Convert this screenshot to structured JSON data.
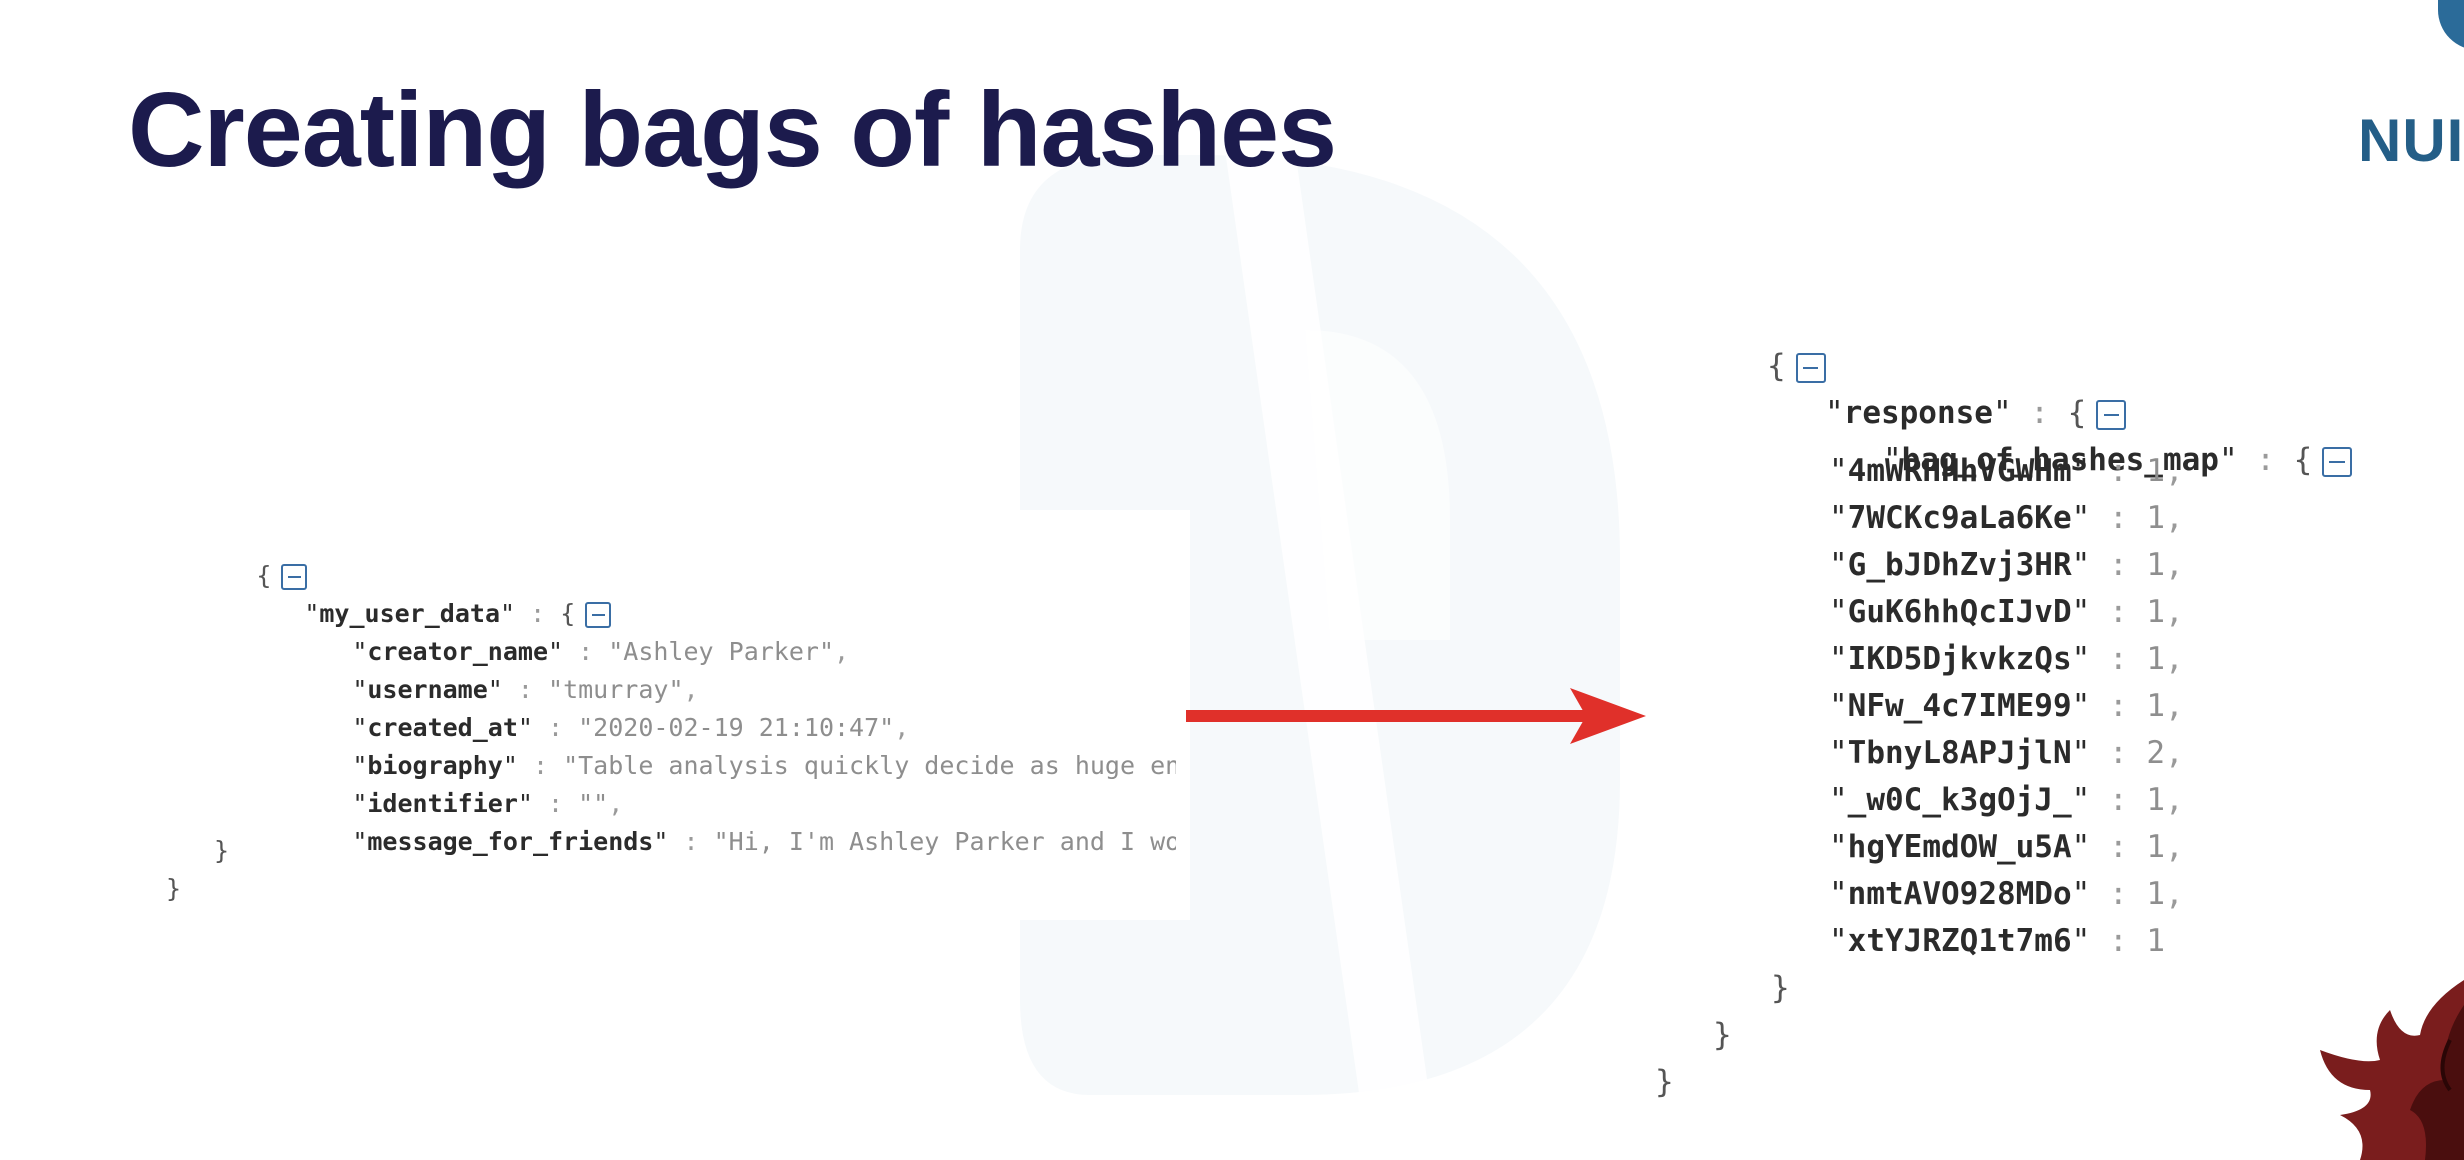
{
  "slide": {
    "title": "Creating bags of hashes",
    "logo_text": "NUI"
  },
  "colors": {
    "title": "#1c1b4d",
    "logo": "#245e87",
    "arrow": "#e0302a",
    "toggle": "#3a6ea5"
  },
  "icons": [
    "collapse-icon",
    "right-arrow-icon",
    "logo-icon",
    "mascot-icon"
  ],
  "left_json": {
    "root_key": "my_user_data",
    "fields": [
      {
        "key": "creator_name",
        "value": "Ashley Parker",
        "sep": ","
      },
      {
        "key": "username",
        "value": "tmurray",
        "sep": ","
      },
      {
        "key": "created_at",
        "value": "2020-02-19 21:10:47",
        "sep": ","
      },
      {
        "key": "biography",
        "value": "Table analysis quickly decide as huge entire.",
        "sep": ""
      },
      {
        "key": "identifier",
        "value": "",
        "sep": ","
      },
      {
        "key": "message_for_friends",
        "value": "Hi, I'm Ashley Parker and I work at",
        "sep": ""
      }
    ]
  },
  "right_json": {
    "outer_key": "response",
    "inner_key": "bag_of_hashes_map",
    "entries": [
      {
        "hash": "4mWRHHhVGWHm",
        "count": "1",
        "sep": ","
      },
      {
        "hash": "7WCKc9aLa6Ke",
        "count": "1",
        "sep": ","
      },
      {
        "hash": "G_bJDhZvj3HR",
        "count": "1",
        "sep": ","
      },
      {
        "hash": "GuK6hhQcIJvD",
        "count": "1",
        "sep": ","
      },
      {
        "hash": "IKD5DjkvkzQs",
        "count": "1",
        "sep": ","
      },
      {
        "hash": "NFw_4c7IME99",
        "count": "1",
        "sep": ","
      },
      {
        "hash": "TbnyL8APJjlN",
        "count": "2",
        "sep": ","
      },
      {
        "hash": "_w0C_k3gOjJ_",
        "count": "1",
        "sep": ","
      },
      {
        "hash": "hgYEmdOW_u5A",
        "count": "1",
        "sep": ","
      },
      {
        "hash": "nmtAVO928MDo",
        "count": "1",
        "sep": ","
      },
      {
        "hash": "xtYJRZQ1t7m6",
        "count": "1",
        "sep": ""
      }
    ]
  }
}
